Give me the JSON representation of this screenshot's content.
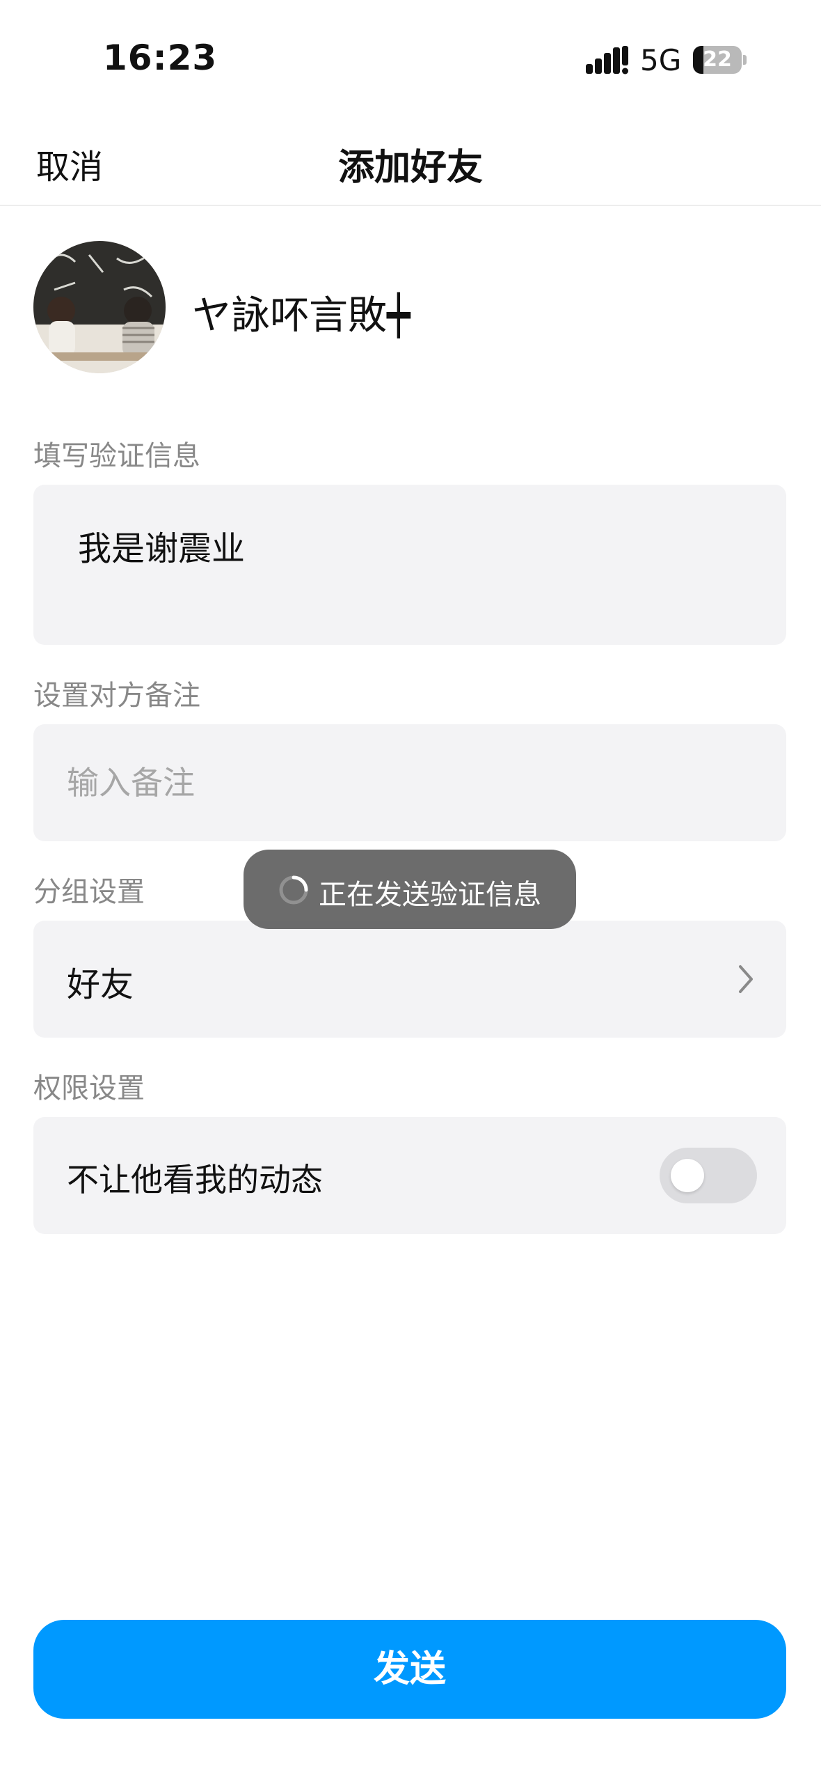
{
  "status_bar": {
    "time": "16:23",
    "network": "5G",
    "battery": "22",
    "battery_fraction": 0.22,
    "signal_icon": "signal-bars-icon",
    "battery_icon": "battery-icon"
  },
  "nav": {
    "cancel_label": "取消",
    "title": "添加好友"
  },
  "profile": {
    "name": "ヤ詠吥言敗┿"
  },
  "verify": {
    "label": "填写验证信息",
    "value": "我是谢震业"
  },
  "remark": {
    "label": "设置对方备注",
    "placeholder": "输入备注"
  },
  "group": {
    "label": "分组设置",
    "value": "好友",
    "icon": "chevron-right-icon"
  },
  "privacy": {
    "label": "权限设置",
    "option": "不让他看我的动态",
    "enabled": false
  },
  "toast": {
    "text": "正在发送验证信息",
    "icon": "spinner-icon"
  },
  "send_label": "发送",
  "colors": {
    "accent": "#0099ff",
    "field_background": "#f3f3f5",
    "toast_background": "#5f5f5f"
  }
}
